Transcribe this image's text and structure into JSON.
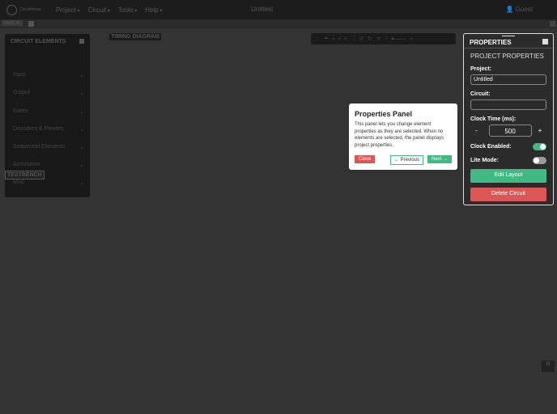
{
  "topbar": {
    "logo": "CircuitVerse",
    "menu": [
      "Project",
      "Circuit",
      "Tools",
      "Help"
    ],
    "title": "Untitled",
    "user": "Guest"
  },
  "tabs": {
    "main": "Main",
    "close": "✕"
  },
  "elements": {
    "title": "CIRCUIT ELEMENTS",
    "items": [
      "Input",
      "Output",
      "Gates",
      "Decoders & Plexers",
      "Sequential Elements",
      "Annotation",
      "Misc"
    ]
  },
  "timing": "TIMING DIAGRAM",
  "testbench": "TESTBENCH",
  "properties": {
    "title": "PROPERTIES",
    "section": "PROJECT PROPERTIES",
    "project_label": "Project:",
    "project_value": "Untitled",
    "circuit_label": "Circuit:",
    "circuit_value": "",
    "clock_label": "Clock Time (ms):",
    "clock_value": "500",
    "minus": "-",
    "plus": "+",
    "clock_enabled_label": "Clock Enabled:",
    "clock_enabled": true,
    "lite_label": "Lite Mode:",
    "lite": false,
    "edit": "Edit Layout",
    "delete": "Delete Circuit"
  },
  "tour": {
    "title": "Properties Panel",
    "body": "This panel lets you change element properties as they are selected. When no elements are selected, the panel displays project properties.",
    "close": "Close",
    "prev": "← Previous",
    "next": "Next →"
  }
}
